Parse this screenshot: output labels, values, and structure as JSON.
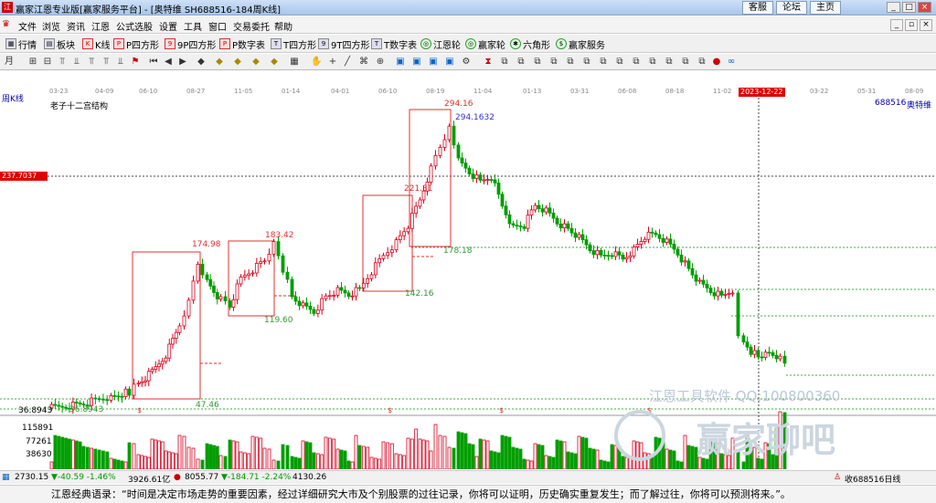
{
  "window": {
    "title": "赢家江恩专业版[赢家服务平台] - [奥特维  SH688516-184周K线]",
    "link1": "客服",
    "link2": "论坛",
    "link3": "主页"
  },
  "menu": [
    "文件",
    "浏览",
    "资讯",
    "江恩",
    "公式选股",
    "设置",
    "工具",
    "窗口",
    "交易委托",
    "帮助"
  ],
  "toolbar": {
    "items": [
      "行情",
      "板块",
      "K线",
      "P四方形",
      "9P四方形",
      "P数字表",
      "T四方形",
      "9T四方形",
      "T数字表",
      "江恩轮",
      "赢家轮",
      "六角形",
      "赢家服务"
    ]
  },
  "chart": {
    "period": "周K线",
    "stock_code": "688516",
    "stock_name": "奥特维",
    "indicator": "老子十二宫结构",
    "dates": [
      "03-23",
      "04-09",
      "06-10",
      "08-27",
      "11-05",
      "01-14",
      "04-01",
      "06-10",
      "08-19",
      "11-04",
      "01-13",
      "03-31",
      "06-08",
      "08-18",
      "11-02",
      "01-05",
      "03-22",
      "05-31",
      "08-09"
    ],
    "highlighted_date": "2023-12-22",
    "price_labels": [
      "294.16",
      "294.1632",
      "221.31",
      "183.42",
      "174.98",
      "178.18",
      "142.16",
      "119.60",
      "47.46",
      "36.8943",
      "36.8943"
    ],
    "axis_label": "237.7037",
    "volume_labels": [
      "115891",
      "77261",
      "38630"
    ]
  },
  "colors": {
    "up": "#d8001c",
    "down": "#009e00",
    "box": "#e03030",
    "grid": "#44aa44"
  },
  "status": {
    "idx1": "2730.15",
    "idx1_chg": "▼-40.59 -1.46%",
    "idx1_amt": "3926.61亿",
    "idx2": "8055.77",
    "idx2_chg": "▼-184.71 -2.24%",
    "idx2_amt": "4130.26",
    "right": "收688516日线"
  },
  "quote": "江恩经典语录：“时间是决定市场走势的重要因素，经过详细研究大市及个别股票的过往记录，你将可以证明，历史确实重复发生；而了解过往，你将可以预测将来。”。",
  "watermark": {
    "line1": "江恩工具软件  QQ:100800360",
    "line2": "赢家聊吧"
  }
}
